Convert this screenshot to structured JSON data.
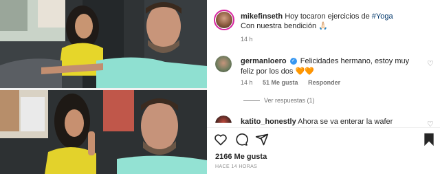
{
  "post": {
    "author": "mikefinseth",
    "caption_prefix": "Hoy tocaron ejercicios de ",
    "caption_tag": "#Yoga",
    "caption_line2": "Con nuestra bendición ",
    "caption_emoji": "🙏🏻",
    "caption_time": "14 h",
    "likes": "2166 Me gusta",
    "post_time": "HACE 14 HORAS"
  },
  "comments": [
    {
      "username": "germanloero",
      "text": "Felicidades hermano, estoy muy feliz por los dos ",
      "emoji": "🧡🧡",
      "time": "14 h",
      "likes": "51 Me gusta",
      "reply": "Responder",
      "view_replies": "Ver respuestas (1)"
    },
    {
      "username": "katito_honestly",
      "text": "Ahora se va enterar la wafer"
    }
  ],
  "icons": {
    "heart": "heart-icon",
    "comment": "comment-icon",
    "share": "share-icon",
    "save": "bookmark-icon",
    "verified": "verified-badge-icon"
  },
  "colors": {
    "link": "#00376b",
    "verified": "#3897f0",
    "story_ring": "#d6249f"
  }
}
